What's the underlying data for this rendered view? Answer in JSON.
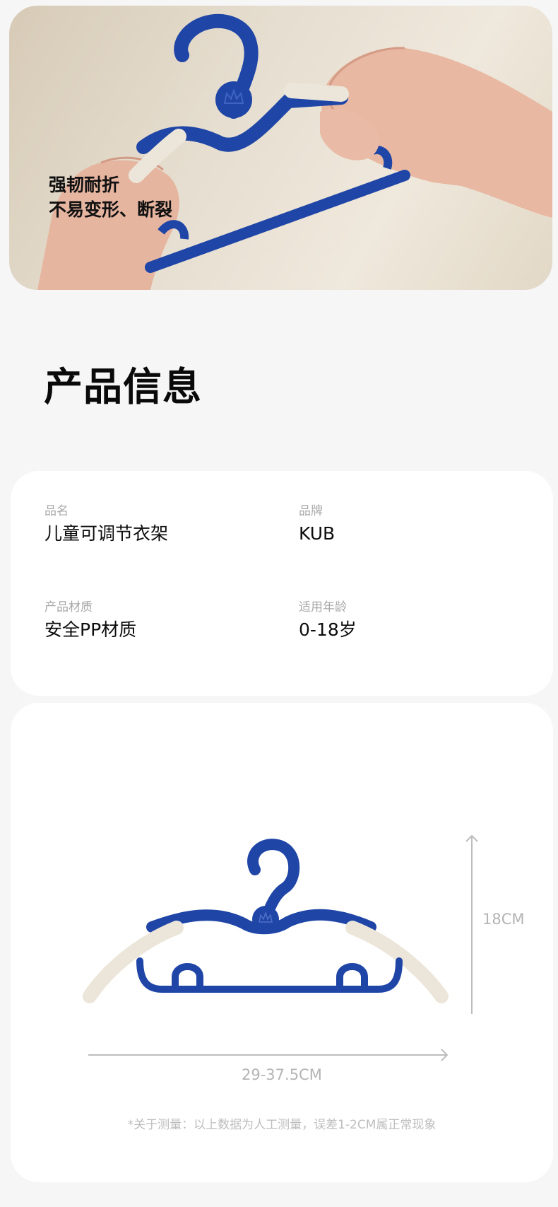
{
  "hero": {
    "caption_line1": "强韧耐折",
    "caption_line2": "不易变形、断裂"
  },
  "section": {
    "title": "产品信息"
  },
  "info": {
    "items": [
      {
        "label": "品名",
        "value": "儿童可调节衣架"
      },
      {
        "label": "品牌",
        "value": "KUB"
      },
      {
        "label": "产品材质",
        "value": "安全PP材质"
      },
      {
        "label": "适用年龄",
        "value": "0-18岁"
      }
    ]
  },
  "dimensions": {
    "height": "18CM",
    "width": "29-37.5CM",
    "note": "*关于测量：以上数据为人工测量，误差1-2CM属正常现象"
  },
  "colors": {
    "hanger_blue": "#1f45a6",
    "hanger_cream": "#ece6da",
    "page_background": "#f6f6f6",
    "card_background": "#ffffff"
  }
}
